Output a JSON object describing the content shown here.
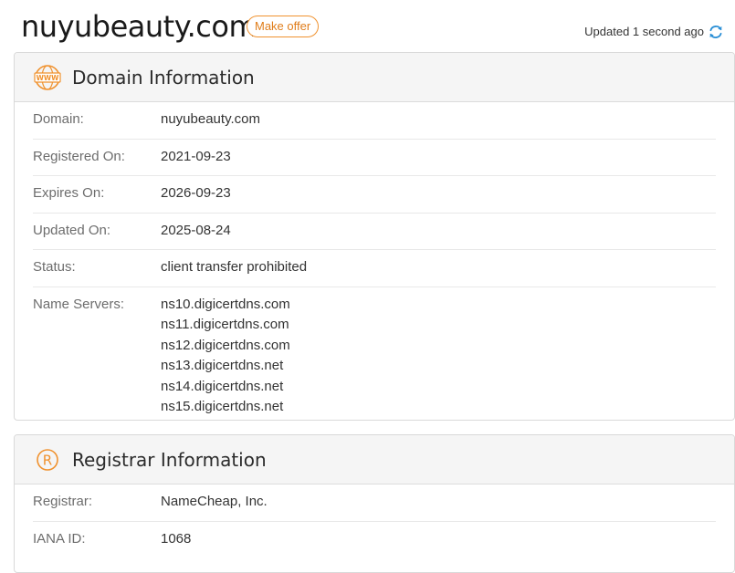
{
  "header": {
    "domain": "nuyubeauty.com",
    "make_offer": "Make offer",
    "updated": "Updated 1 second ago"
  },
  "domain_info": {
    "title": "Domain Information",
    "icon": "www-icon",
    "rows": {
      "domain": {
        "label": "Domain:",
        "value": "nuyubeauty.com"
      },
      "registered": {
        "label": "Registered On:",
        "value": "2021-09-23"
      },
      "expires": {
        "label": "Expires On:",
        "value": "2026-09-23"
      },
      "updated": {
        "label": "Updated On:",
        "value": "2025-08-24"
      },
      "status": {
        "label": "Status:",
        "value": "client transfer prohibited"
      },
      "name_servers": {
        "label": "Name Servers:",
        "values": [
          "ns10.digicertdns.com",
          "ns11.digicertdns.com",
          "ns12.digicertdns.com",
          "ns13.digicertdns.net",
          "ns14.digicertdns.net",
          "ns15.digicertdns.net"
        ]
      }
    }
  },
  "registrar_info": {
    "title": "Registrar Information",
    "icon": "registered-icon",
    "rows": {
      "registrar": {
        "label": "Registrar:",
        "value": "NameCheap, Inc."
      },
      "iana": {
        "label": "IANA ID:",
        "value": "1068"
      }
    }
  },
  "colors": {
    "accent": "#f0922f",
    "refresh": "#2a8fd6"
  }
}
